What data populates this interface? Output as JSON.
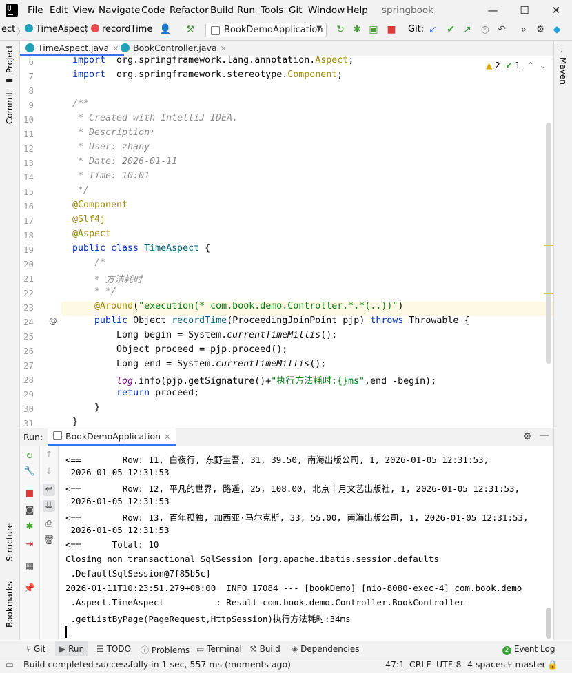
{
  "app": {
    "logo": "IJ",
    "menu": [
      "File",
      "Edit",
      "View",
      "Navigate",
      "Code",
      "Refactor",
      "Build",
      "Run",
      "Tools",
      "Git",
      "Window",
      "Help"
    ],
    "window_title": "springbook"
  },
  "toolbar": {
    "crumb_partial": "ect",
    "crumb_class": "TimeAspect",
    "crumb_method": "recordTime",
    "run_config": "BookDemoApplication",
    "git_label": "Git:"
  },
  "editor_tabs": [
    {
      "label": "TimeAspect.java"
    },
    {
      "label": "BookController.java"
    }
  ],
  "side_labels": {
    "project": "Project",
    "commit": "Commit",
    "structure": "Structure",
    "bookmarks": "Bookmarks",
    "maven": "Maven"
  },
  "inspection": {
    "warnings": "2",
    "ok": "1"
  },
  "gutter_marker": "@",
  "code_lines": [
    {
      "n": "6",
      "parts": [
        [
          "kw",
          "import"
        ],
        [
          "",
          "  org.springframework.lang.annotation."
        ],
        [
          "an",
          "Aspect"
        ],
        [
          "",
          ";"
        ]
      ]
    },
    {
      "n": "7",
      "parts": [
        [
          "kw",
          "import"
        ],
        [
          "",
          "  org.springframework.stereotype."
        ],
        [
          "an",
          "Component"
        ],
        [
          "",
          ";"
        ]
      ]
    },
    {
      "n": "8",
      "parts": []
    },
    {
      "n": "9",
      "parts": [
        [
          "cm",
          "/**"
        ]
      ]
    },
    {
      "n": "10",
      "parts": [
        [
          "cm",
          " * Created with IntelliJ IDEA."
        ]
      ]
    },
    {
      "n": "11",
      "parts": [
        [
          "cm",
          " * Description:"
        ]
      ]
    },
    {
      "n": "12",
      "parts": [
        [
          "cm",
          " * User: zhany"
        ]
      ]
    },
    {
      "n": "13",
      "parts": [
        [
          "cm",
          " * Date: 2026-01-11"
        ]
      ]
    },
    {
      "n": "14",
      "parts": [
        [
          "cm",
          " * Time: 10:01"
        ]
      ]
    },
    {
      "n": "15",
      "parts": [
        [
          "cm",
          " */"
        ]
      ]
    },
    {
      "n": "16",
      "parts": [
        [
          "an",
          "@Component"
        ]
      ]
    },
    {
      "n": "17",
      "parts": [
        [
          "an",
          "@Slf4j"
        ]
      ]
    },
    {
      "n": "18",
      "parts": [
        [
          "an",
          "@Aspect"
        ]
      ]
    },
    {
      "n": "19",
      "parts": [
        [
          "kw",
          "public class "
        ],
        [
          "gr",
          "TimeAspect"
        ],
        [
          "",
          " {"
        ]
      ]
    },
    {
      "n": "20",
      "parts": [
        [
          "cm",
          "    /*"
        ]
      ]
    },
    {
      "n": "21",
      "parts": [
        [
          "cm",
          "    * 方法耗时"
        ]
      ]
    },
    {
      "n": "22",
      "parts": [
        [
          "cm",
          "    * */"
        ]
      ]
    },
    {
      "n": "23",
      "parts": [
        [
          "",
          "    "
        ],
        [
          "an",
          "@Around"
        ],
        [
          "",
          "("
        ],
        [
          "st",
          "\"execution(* com.book.demo.Controller.*.*(..))\""
        ],
        [
          "",
          ")"
        ]
      ]
    },
    {
      "n": "24",
      "parts": [
        [
          "",
          "    "
        ],
        [
          "kw",
          "public "
        ],
        [
          "",
          "Object "
        ],
        [
          "fn",
          "recordTime"
        ],
        [
          "",
          "(ProceedingJoinPoint pjp) "
        ],
        [
          "kw",
          "throws "
        ],
        [
          "",
          "Throwable {"
        ]
      ]
    },
    {
      "n": "25",
      "parts": [
        [
          "",
          "        Long begin = System."
        ],
        [
          "mt",
          "currentTimeMillis"
        ],
        [
          "",
          "();"
        ]
      ]
    },
    {
      "n": "26",
      "parts": [
        [
          "",
          "        Object proceed = pjp.proceed();"
        ]
      ]
    },
    {
      "n": "27",
      "parts": [
        [
          "",
          "        Long end = System."
        ],
        [
          "mt",
          "currentTimeMillis"
        ],
        [
          "",
          "();"
        ]
      ]
    },
    {
      "n": "28",
      "parts": [
        [
          "",
          "        "
        ],
        [
          "fd",
          "log"
        ],
        [
          "",
          ".info(pjp.getSignature()+"
        ],
        [
          "st",
          "\"执行方法耗时:{}ms\""
        ],
        [
          "",
          ",end -begin);"
        ]
      ]
    },
    {
      "n": "29",
      "parts": [
        [
          "",
          "        "
        ],
        [
          "kw",
          "return "
        ],
        [
          "",
          "proceed;"
        ]
      ]
    },
    {
      "n": "30",
      "parts": [
        [
          "",
          "    }"
        ]
      ]
    },
    {
      "n": "31",
      "parts": [
        [
          "",
          "}"
        ]
      ]
    }
  ],
  "run_panel": {
    "label": "Run:",
    "tab": "BookDemoApplication"
  },
  "console_lines": [
    "  12:31:53",
    "<==        Row: 11, 白夜行, 东野圭吾, 31, 39.50, 南海出版公司, 1, 2026-01-05 12:31:53,",
    " 2026-01-05 12:31:53",
    "<==        Row: 12, 平凡的世界, 路遥, 25, 108.00, 北京十月文艺出版社, 1, 2026-01-05 12:31:53,",
    " 2026-01-05 12:31:53",
    "<==        Row: 13, 百年孤独, 加西亚·马尔克斯, 33, 55.00, 南海出版公司, 1, 2026-01-05 12:31:53,",
    " 2026-01-05 12:31:53",
    "<==      Total: 10",
    "Closing non transactional SqlSession [org.apache.ibatis.session.defaults",
    " .DefaultSqlSession@7f85b5c]",
    "2026-01-11T10:23:51.279+08:00  INFO 17084 --- [bookDemo] [nio-8080-exec-4] com.book.demo",
    " .Aspect.TimeAspect          : Result com.book.demo.Controller.BookController",
    " .getListByPage(PageRequest,HttpSession)执行方法耗时:34ms"
  ],
  "bottom_tools": [
    "Git",
    "Run",
    "TODO",
    "Problems",
    "Terminal",
    "Build",
    "Dependencies"
  ],
  "event_log": {
    "count": "2",
    "label": "Event Log"
  },
  "status": {
    "message": "Build completed successfully in 1 sec, 557 ms (moments ago)",
    "position": "47:1",
    "line_sep": "CRLF",
    "encoding": "UTF-8",
    "indent": "4 spaces",
    "branch": "master"
  },
  "colors": {
    "accent": "#3574f0",
    "keyword": "#0033b3",
    "annotation": "#9e880d",
    "string": "#067d17",
    "comment": "#8c8c8c"
  }
}
